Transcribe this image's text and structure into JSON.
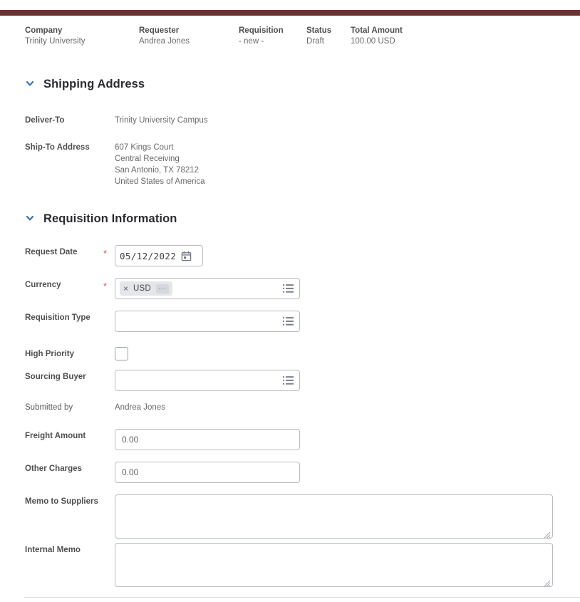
{
  "theme": {
    "topbar_color": "#6e3133",
    "required_star_color": "#d9534f",
    "chevron_color": "#2f6fbd",
    "border_color": "#b6bcc4"
  },
  "summary": {
    "items": [
      {
        "label": "Company",
        "value": "Trinity University"
      },
      {
        "label": "Requester",
        "value": "Andrea Jones"
      },
      {
        "label": "Requisition",
        "value": "- new -"
      },
      {
        "label": "Status",
        "value": "Draft"
      },
      {
        "label": "Total Amount",
        "value": "100.00 USD"
      }
    ]
  },
  "shipping_section": {
    "title": "Shipping Address",
    "chevron": "chevron-down-icon",
    "deliver_to": {
      "label": "Deliver-To",
      "value": "Trinity University Campus"
    },
    "ship_to_address": {
      "label": "Ship-To Address",
      "value": "607 Kings Court\nCentral Receiving\nSan Antonio, TX 78212\nUnited States of America"
    }
  },
  "requisition_section": {
    "title": "Requisition Information",
    "chevron": "chevron-down-icon",
    "request_date": {
      "label": "Request Date",
      "required": "*",
      "value": "05/12/2022",
      "icon": "calendar-icon"
    },
    "currency": {
      "label": "Currency",
      "required": "*",
      "chip_value": "USD",
      "chip_remove": "×",
      "chip_more": "···",
      "icon": "list-menu-icon"
    },
    "requisition_type": {
      "label": "Requisition Type",
      "value": "",
      "icon": "list-menu-icon"
    },
    "high_priority": {
      "label": "High Priority",
      "checked": false
    },
    "sourcing_buyer": {
      "label": "Sourcing Buyer",
      "value": "",
      "icon": "list-menu-icon"
    },
    "submitted_by": {
      "label": "Submitted by",
      "value": "Andrea Jones"
    },
    "freight_amount": {
      "label": "Freight Amount",
      "value": "0.00"
    },
    "other_charges": {
      "label": "Other Charges",
      "value": "0.00"
    },
    "memo_to_suppliers": {
      "label": "Memo to Suppliers",
      "value": ""
    },
    "internal_memo": {
      "label": "Internal Memo",
      "value": ""
    }
  }
}
